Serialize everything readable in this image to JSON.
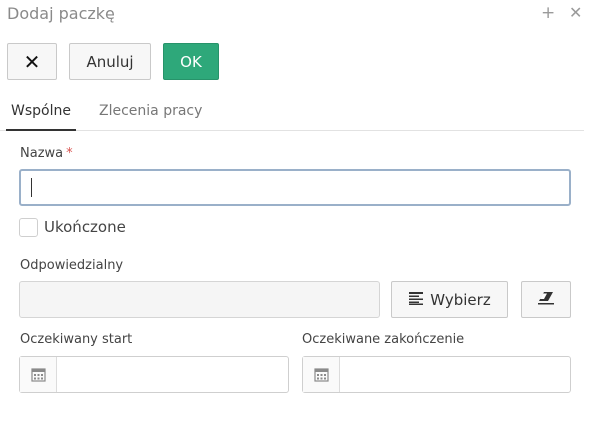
{
  "window": {
    "title": "Dodaj paczkę",
    "plus_icon": "+",
    "close_icon": "✕"
  },
  "toolbar": {
    "close_label": "✕",
    "cancel_label": "Anuluj",
    "ok_label": "OK",
    "ok_color": "#2ea87a"
  },
  "tabs": [
    {
      "label": "Wspólne",
      "active": true
    },
    {
      "label": "Zlecenia pracy",
      "active": false
    }
  ],
  "form": {
    "name": {
      "label": "Nazwa",
      "required_mark": "*",
      "value": ""
    },
    "completed": {
      "label": "Ukończone",
      "checked": false
    },
    "responsible": {
      "label": "Odpowiedzialny",
      "value": "",
      "choose_label": "Wybierz",
      "choose_icon": "list-icon",
      "clear_icon": "eraser-icon"
    },
    "expected_start": {
      "label": "Oczekiwany start",
      "value": ""
    },
    "expected_end": {
      "label": "Oczekiwane zakończenie",
      "value": ""
    }
  }
}
